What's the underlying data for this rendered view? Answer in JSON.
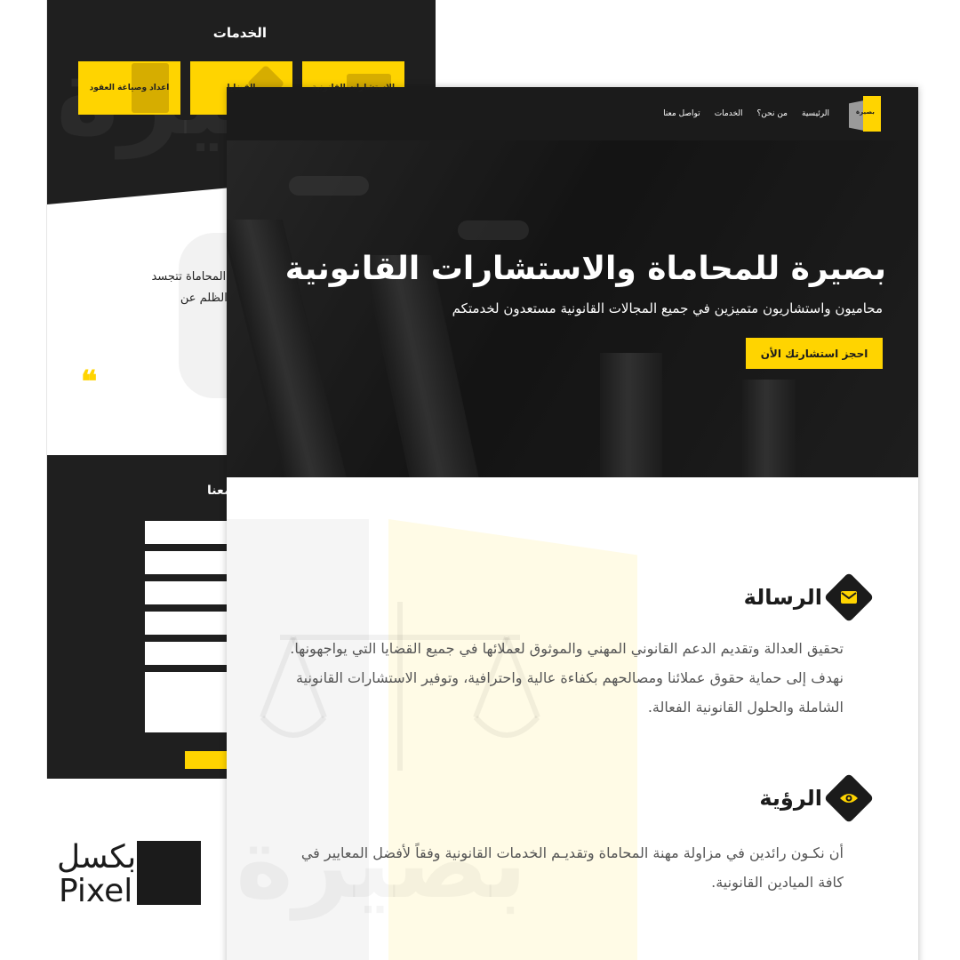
{
  "back_mockup": {
    "services_title": "الخدمات",
    "service_cards": [
      "اعداد وصياغة العقود",
      "القضايا",
      "الاستشارات القانونية"
    ],
    "quote_text": "الإنسان على قارعة المحكمة فقط، بل إنّ المحاماة تتجسد يتعرض لها الإنسان أمام كانت مهمتها رفع الظلم عن",
    "quote_mark": "❝",
    "contact_title": "معنا"
  },
  "nav": {
    "logo_text": "بصيرة",
    "links": [
      "الرئيسية",
      "من نحن؟",
      "الخدمات",
      "تواصل معنا"
    ]
  },
  "hero": {
    "title": "بصيرة للمحاماة والاستشارات القانونية",
    "subtitle": "محاميون واستشاريون متميزين في جميع المجالات القانونية مستعدون لخدمتكم",
    "cta": "احجز استشارتك الأن"
  },
  "mission": {
    "title": "الرسالة",
    "icon": "envelope-icon",
    "body": "تحقيق العدالة وتقديم الدعم القانوني المهني والموثوق لعملائها في جميع القضايا التي يواجهونها. نهدف إلى حماية حقوق عملائنا ومصالحهم بكفاءة عالية واحترافية، وتوفير الاستشارات القانونية الشاملة والحلول القانونية الفعالة."
  },
  "vision": {
    "title": "الرؤية",
    "icon": "eye-icon",
    "body": "أن نكـون رائدين في مزاولة مهنة المحاماة وتقديـم الخدمات القانونية وفقاً لأفضل المعايير في كافة الميادين القانونية."
  },
  "watermark_text": "بصيرة",
  "brand": {
    "arabic": "بكسل",
    "english": "Pixel"
  },
  "colors": {
    "accent": "#ffd400",
    "dark": "#1b1b1b",
    "body_text": "#555555"
  }
}
